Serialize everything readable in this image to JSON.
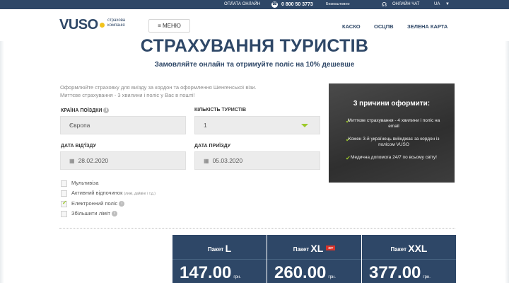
{
  "topbar": {
    "pay_online": "ОПЛАТА ОНЛАЙН",
    "phone_icon": "phone-icon",
    "phone": "0 800 50 3773",
    "phone_note": "Безкоштовно",
    "chat_icon": "headset-icon",
    "chat": "ОНЛАЙН ЧАТ",
    "lang": "UA"
  },
  "header": {
    "logo": "VUSO",
    "logo_sub": "страхова компанія",
    "menu_label": "≡ МЕНЮ",
    "nav": [
      "КАСКО",
      "ОСЦПВ",
      "ЗЕЛЕНА КАРТА"
    ]
  },
  "hero": {
    "title": "СТРАХУВАННЯ ТУРИСТІВ",
    "subtitle": "Замовляйте онлайн та отримуйте поліс на 10% дешевше"
  },
  "form": {
    "intro_line1": "Оформлюйте страховку для виїзду за кордон та оформлення Шенгенської візи.",
    "intro_line2": "Миттєве страхування - 3 хвилини і поліс у Вас в пошті!",
    "country_label": "КРАЇНА ПОЇЗДКИ",
    "country_value": "Європа",
    "tourists_label": "КІЛЬКІСТЬ ТУРИСТІВ",
    "tourists_value": "1",
    "depart_label": "ДАТА ВІД'ЇЗДУ",
    "depart_value": "28.02.2020",
    "arrive_label": "ДАТА ПРИЇЗДУ",
    "arrive_value": "05.03.2020",
    "options": [
      {
        "label": "Мультивіза",
        "note": "",
        "checked": false,
        "info": false
      },
      {
        "label": "Активний відпочинок",
        "note": "(лижі, дайвінг і т.д.)",
        "checked": false,
        "info": false
      },
      {
        "label": "Електронний поліс",
        "note": "",
        "checked": true,
        "info": true
      },
      {
        "label": "Збільшити ліміт",
        "note": "",
        "checked": false,
        "info": true
      }
    ]
  },
  "promo": {
    "title": "3 причини оформити:",
    "items": [
      "Миттєве страхування - 4 хвилини і поліс на email",
      "Кожен 3-й українець виїжджає за кордон із полісом VUSO",
      "Медична допомога 24/7 по всьому світу!"
    ]
  },
  "packages": [
    {
      "prefix": "Пакет",
      "size": "L",
      "badge": "",
      "price": "147.00",
      "currency": "грн."
    },
    {
      "prefix": "Пакет",
      "size": "XL",
      "badge": "ХІТ",
      "price": "260.00",
      "currency": "грн."
    },
    {
      "prefix": "Пакет",
      "size": "XXL",
      "badge": "",
      "price": "377.00",
      "currency": "грн."
    }
  ],
  "colors": {
    "brand": "#2e4767",
    "accent": "#9cc92a",
    "badge": "#d9342b"
  }
}
